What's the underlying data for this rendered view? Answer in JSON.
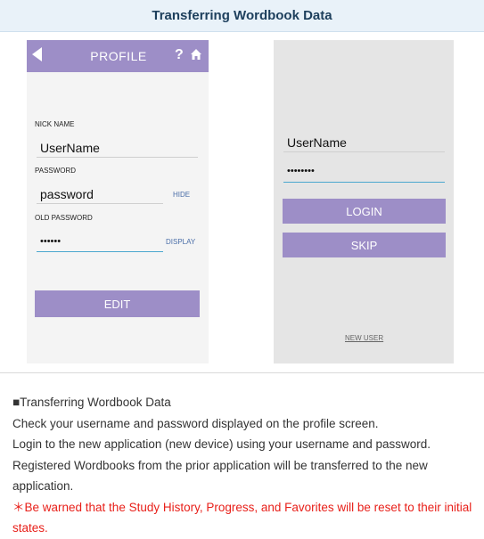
{
  "banner": {
    "title": "Transferring Wordbook Data"
  },
  "profile_screen": {
    "header_title": "PROFILE",
    "help_label": "?",
    "nick_name_label": "NICK NAME",
    "nick_name_value": "UserName",
    "password_label": "PASSWORD",
    "password_value": "password",
    "hide_label": "HIDE",
    "old_password_label": "OLD PASSWORD",
    "old_password_value": "••••••",
    "display_label": "DISPLAY",
    "edit_button": "EDIT"
  },
  "login_screen": {
    "username_value": "UserName",
    "password_value": "••••••••",
    "login_button": "LOGIN",
    "skip_button": "SKIP",
    "new_user_link": "NEW USER"
  },
  "description": {
    "heading": "■Transferring Wordbook Data",
    "line1": "Check your username and password displayed on the profile screen.",
    "line2": "Login to the new application (new device) using your username and password.",
    "line3": "Registered Wordbooks from the prior application will be transferred to the new application.",
    "warning": "＊Be warned that the Study History, Progress, and Favorites will be reset to their initial states."
  },
  "colors": {
    "accent_purple": "#9d8ec7",
    "warning_red": "#e8201a",
    "active_underline": "#4aa7cf"
  },
  "icons": [
    "back-arrow-icon",
    "help-icon",
    "home-icon"
  ]
}
